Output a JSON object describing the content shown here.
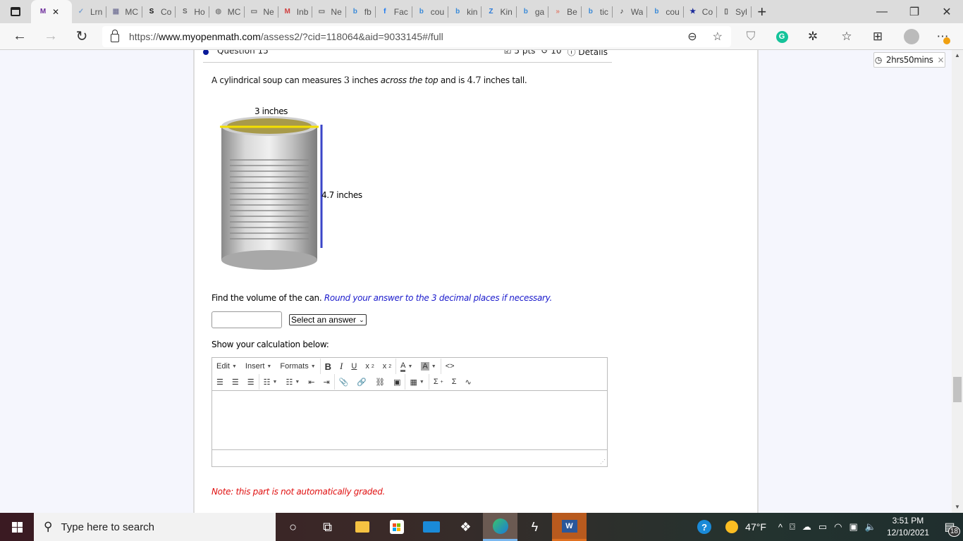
{
  "browser": {
    "tabs": [
      {
        "label": "",
        "icon": "myopenmath-icon",
        "active": true,
        "favicon_text": "M",
        "favicon_color": "#6b2a9a"
      },
      {
        "label": "Lrn",
        "icon": "learn-icon",
        "favicon_text": "✓",
        "favicon_color": "#7aa0d0"
      },
      {
        "label": "MC",
        "icon": "mc-icon",
        "favicon_text": "▦",
        "favicon_color": "#8080a0"
      },
      {
        "label": "Co",
        "icon": "skype-icon",
        "favicon_text": "S",
        "favicon_color": "#111"
      },
      {
        "label": "Ho",
        "icon": "skype-icon",
        "favicon_text": "S",
        "favicon_color": "#666"
      },
      {
        "label": "MC",
        "icon": "mc-icon",
        "favicon_text": "◍",
        "favicon_color": "#888"
      },
      {
        "label": "Ne",
        "icon": "newtab-icon",
        "favicon_text": "▭",
        "favicon_color": "#666"
      },
      {
        "label": "Inb",
        "icon": "gmail-icon",
        "favicon_text": "M",
        "favicon_color": "#d04040"
      },
      {
        "label": "Ne",
        "icon": "newtab-icon",
        "favicon_text": "▭",
        "favicon_color": "#666"
      },
      {
        "label": "fb",
        "icon": "bing-icon",
        "favicon_text": "b",
        "favicon_color": "#3a8ad8"
      },
      {
        "label": "Fac",
        "icon": "facebook-icon",
        "favicon_text": "f",
        "favicon_color": "#1877f2"
      },
      {
        "label": "cou",
        "icon": "bing-icon",
        "favicon_text": "b",
        "favicon_color": "#3a8ad8"
      },
      {
        "label": "kin",
        "icon": "bing-icon",
        "favicon_text": "b",
        "favicon_color": "#3a8ad8"
      },
      {
        "label": "Kin",
        "icon": "zillow-icon",
        "favicon_text": "Z",
        "favicon_color": "#2a7ad8"
      },
      {
        "label": "ga",
        "icon": "bing-icon",
        "favicon_text": "b",
        "favicon_color": "#3a8ad8"
      },
      {
        "label": "Be",
        "icon": "arrows-icon",
        "favicon_text": "»",
        "favicon_color": "#e08070"
      },
      {
        "label": "tic",
        "icon": "bing-icon",
        "favicon_text": "b",
        "favicon_color": "#3a8ad8"
      },
      {
        "label": "Wa",
        "icon": "tiktok-icon",
        "favicon_text": "♪",
        "favicon_color": "#222"
      },
      {
        "label": "cou",
        "icon": "bing-icon",
        "favicon_text": "b",
        "favicon_color": "#3a8ad8"
      },
      {
        "label": "Co",
        "icon": "shield-star-icon",
        "favicon_text": "★",
        "favicon_color": "#1a2a9a"
      },
      {
        "label": "Syl",
        "icon": "document-icon",
        "favicon_text": "▯",
        "favicon_color": "#555"
      }
    ],
    "url_scheme": "https://",
    "url_host": "www.myopenmath.com",
    "url_path": "/assess2/?cid=118064&aid=9033145#/full"
  },
  "question": {
    "title": "Question 15",
    "points": "5 pts",
    "attempts": "10",
    "details_label": "Details",
    "text_part1": "A cylindrical soup can measures ",
    "diameter_value": "3",
    "text_part2": " inches ",
    "text_emph": "across the top",
    "text_part3": " and is ",
    "height_value": "4.7",
    "text_part4": " inches tall.",
    "image_label_diameter": "3 inches",
    "image_label_height": "4.7 inches",
    "find_text": "Find the volume of the can. ",
    "find_hint": "Round your answer to the 3 decimal places if necessary.",
    "answer_value": "",
    "unit_select": "Select an answer",
    "show_calc_label": "Show your calculation below:",
    "note": "Note: this part is not automatically graded."
  },
  "editor": {
    "menus": [
      "Edit",
      "Insert",
      "Formats"
    ],
    "colors": {
      "highlight": "#aaaaaa"
    }
  },
  "timer": {
    "label": "2hrs50mins"
  },
  "taskbar": {
    "search_placeholder": "Type here to search",
    "weather": "47°F",
    "time": "3:51 PM",
    "date": "12/10/2021",
    "notifications": "18"
  }
}
